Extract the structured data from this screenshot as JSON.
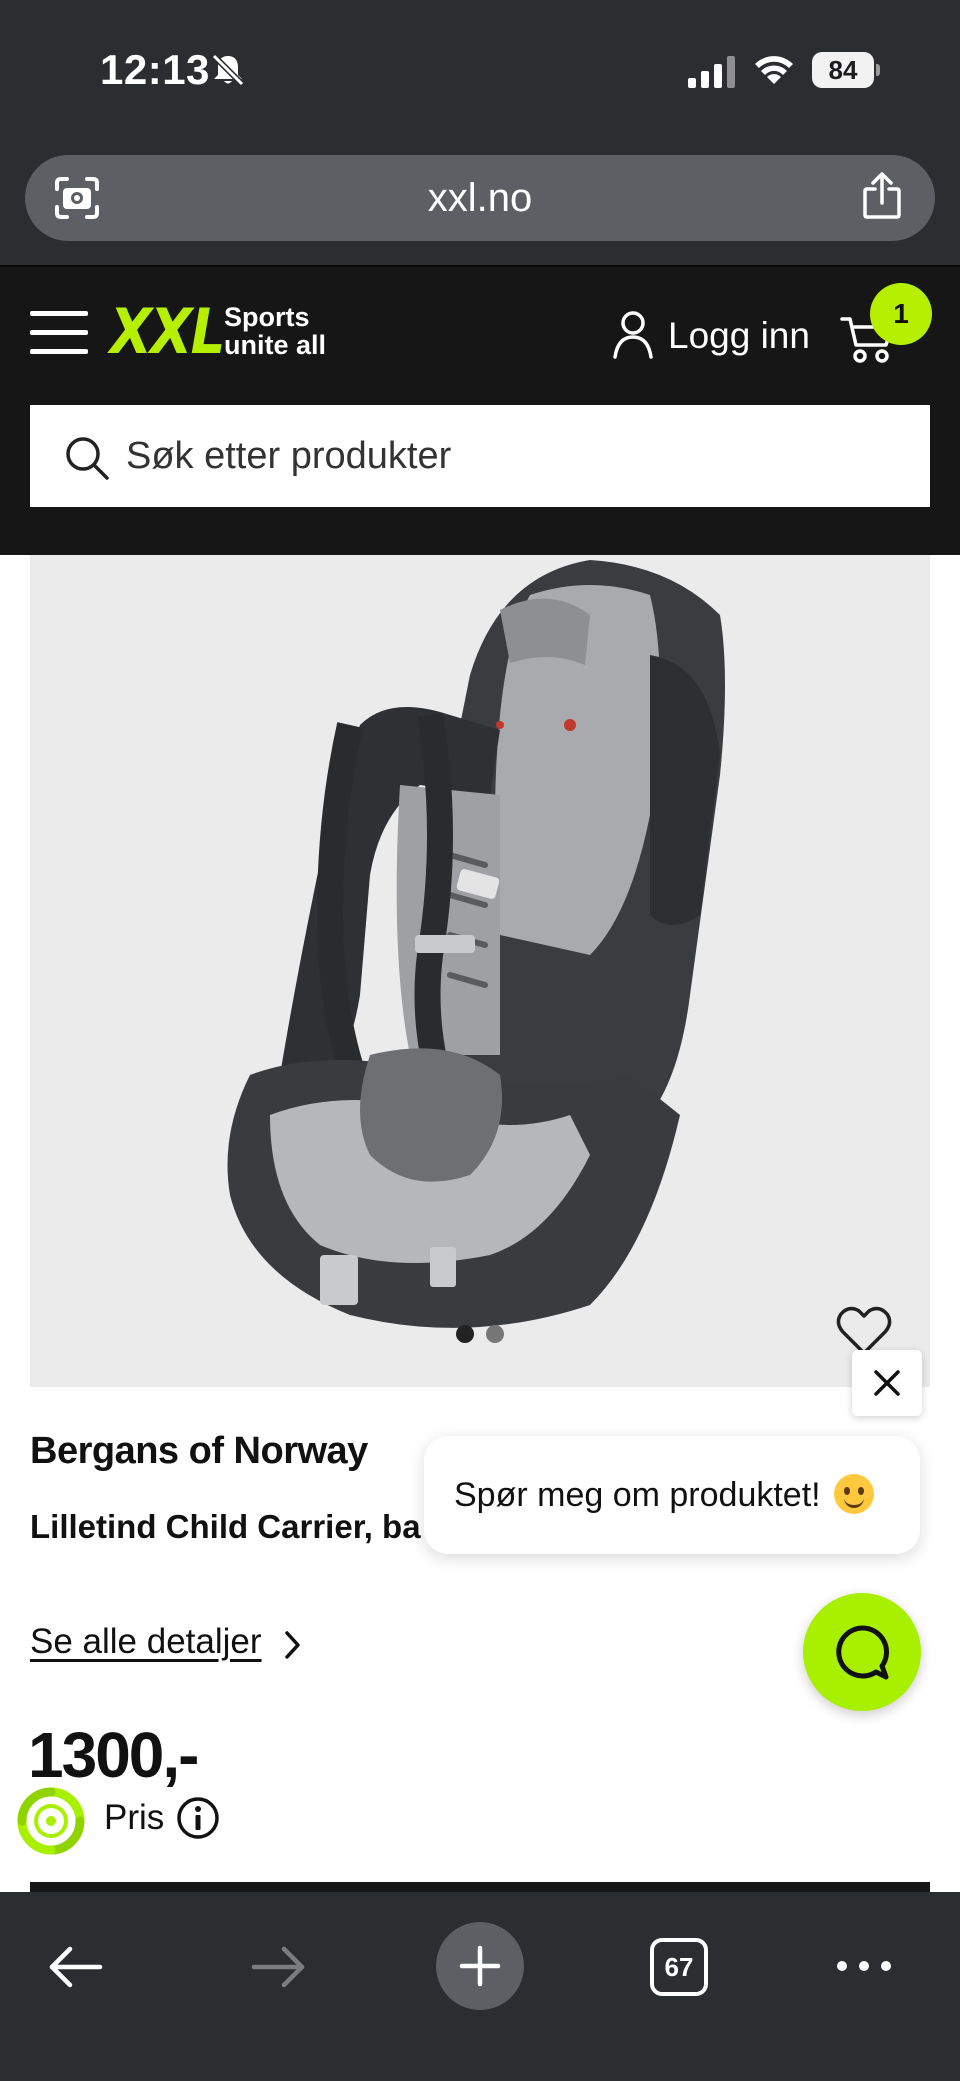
{
  "status_bar": {
    "time": "12:13",
    "battery": "84"
  },
  "browser": {
    "url": "xxl.no"
  },
  "header": {
    "logo_text": "XXL",
    "tagline_line1": "Sports",
    "tagline_line2": "unite all",
    "login_label": "Logg inn",
    "cart_count": "1",
    "search_placeholder": "Søk etter produkter"
  },
  "product": {
    "brand": "Bergans of Norway",
    "name": "Lilletind Child Carrier, ba",
    "details_link": "Se alle detaljer",
    "price": "1300,-",
    "price_label": "Pris",
    "image_dots": {
      "count": 2,
      "active_index": 0
    }
  },
  "chat": {
    "prompt": "Spør meg om produktet!"
  },
  "toolbar": {
    "tab_count": "67"
  },
  "colors": {
    "accent": "#b6f000",
    "header_bg": "#161616",
    "browser_chrome": "#2b2d30"
  }
}
